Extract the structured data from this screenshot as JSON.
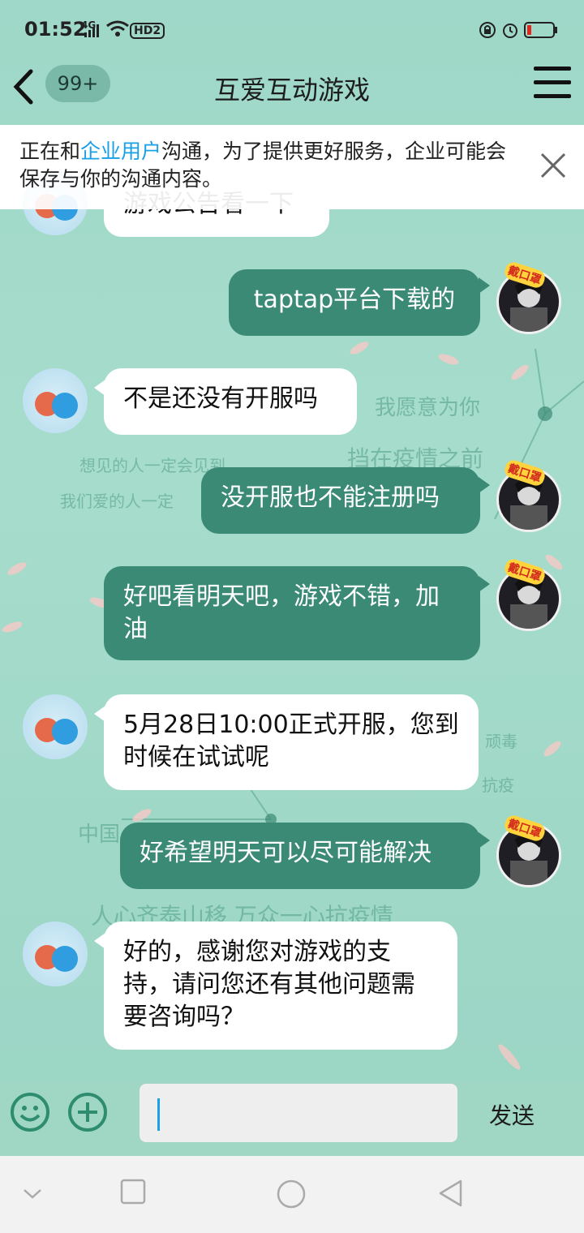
{
  "status_bar": {
    "time": "01:52",
    "network": "4G",
    "hd_label": "HD2"
  },
  "header": {
    "badge": "99+",
    "title": "互爱互动游戏"
  },
  "notice": {
    "prefix": "正在和",
    "link": "企业用户",
    "suffix": "沟通，为了提供更好服务，企业可能会保存与你的沟通内容。"
  },
  "messages": [
    {
      "side": "in",
      "text": "游戏公告看一下"
    },
    {
      "side": "out",
      "text": "taptap平台下载的"
    },
    {
      "side": "in",
      "text": "不是还没有开服吗"
    },
    {
      "side": "out",
      "text": "没开服也不能注册吗"
    },
    {
      "side": "out",
      "text": "好吧看明天吧，游戏不错，加油"
    },
    {
      "side": "in",
      "text": "5月28日10:00正式开服，您到时候在试试呢"
    },
    {
      "side": "out",
      "text": "好希望明天可以尽可能解决"
    },
    {
      "side": "in",
      "text": "好的，感谢您对游戏的支持，请问您还有其他问题需要咨询吗？"
    }
  ],
  "sticker_label": "戴口罩",
  "background_words": [
    "我愿意为你",
    "挡在疫情之前",
    "想见的人一定会见到",
    "我们爱的人一定",
    "顽毒",
    "抗疫",
    "中国",
    "人心齐泰山移 万众一心抗疫情"
  ],
  "input_bar": {
    "placeholder": "",
    "send_label": "发送"
  },
  "colors": {
    "accent": "#3b8a76",
    "link": "#1aa0e6",
    "background": "#a9dccb"
  }
}
